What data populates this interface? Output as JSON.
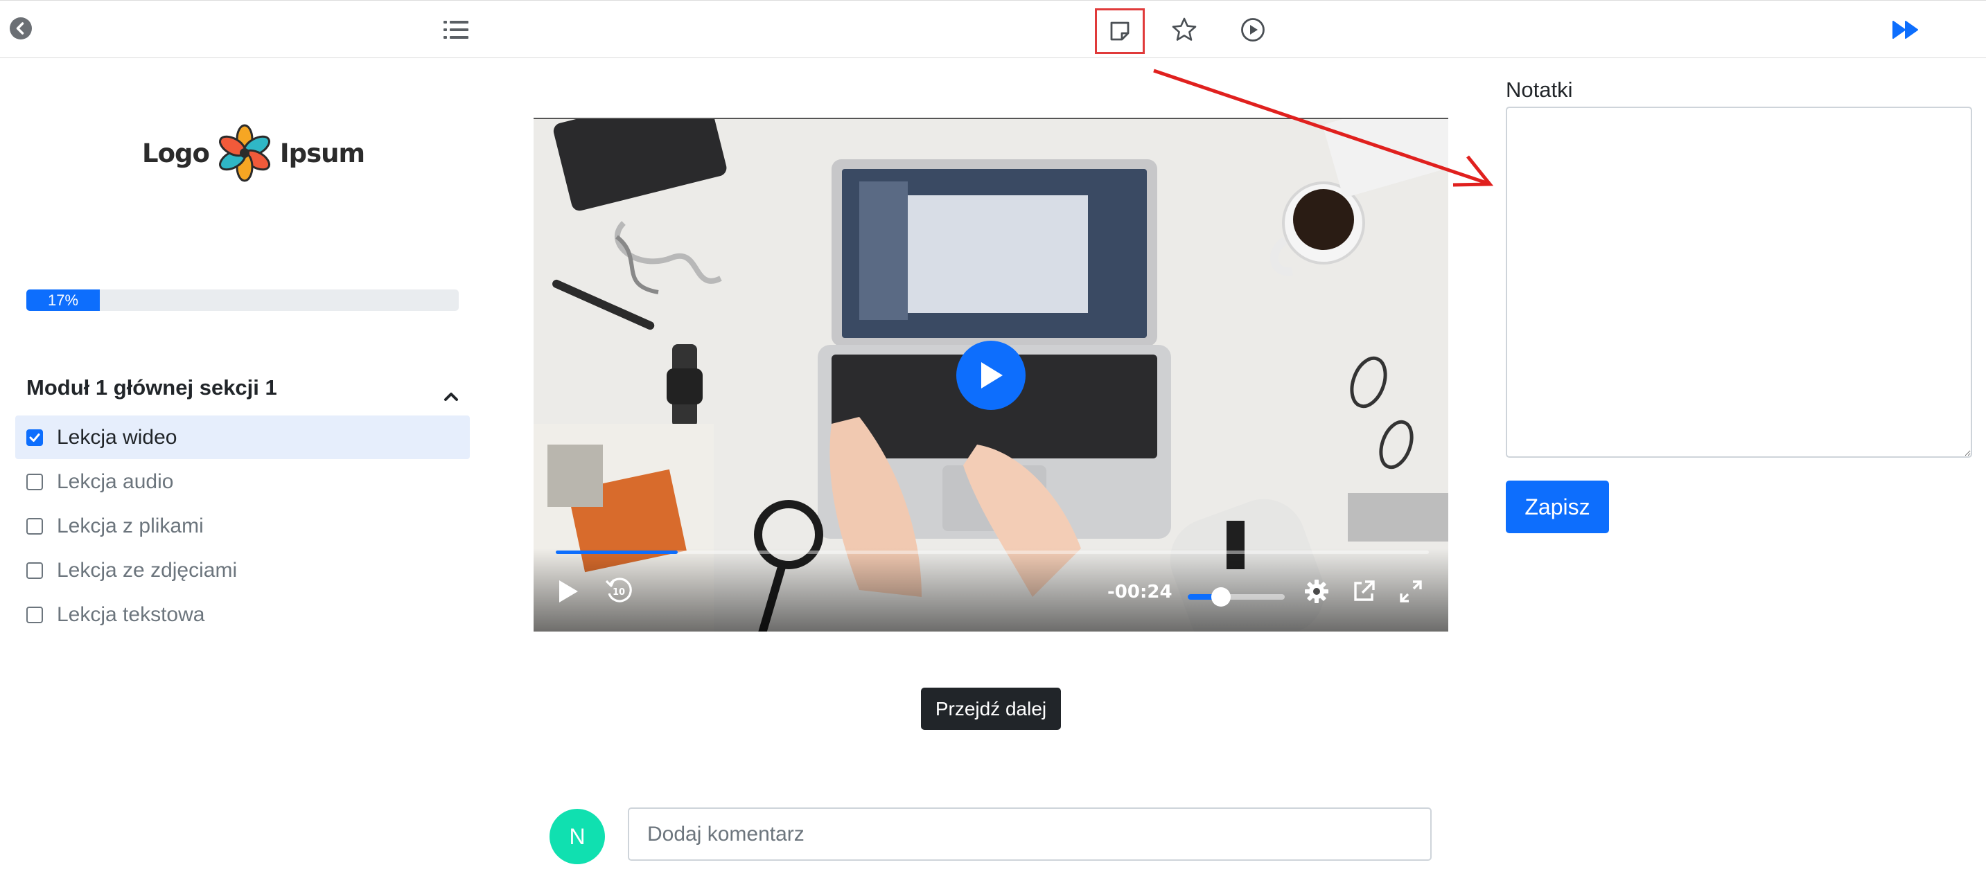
{
  "toolbar": {
    "icons": [
      "back-circle-icon",
      "list-icon",
      "note-icon",
      "star-icon",
      "play-circle-icon",
      "fast-forward-icon"
    ],
    "accent": "#0d6efd",
    "highlight_color": "#e03a3a"
  },
  "sidebar": {
    "logo_left": "Logo",
    "logo_right": "Ipsum",
    "progress": {
      "percent": 17,
      "label": "17%"
    },
    "module": {
      "title": "Moduł 1 głównej sekcji 1",
      "expanded": true
    },
    "lessons": [
      {
        "label": "Lekcja wideo",
        "checked": true,
        "active": true
      },
      {
        "label": "Lekcja audio",
        "checked": false,
        "active": false
      },
      {
        "label": "Lekcja z plikami",
        "checked": false,
        "active": false
      },
      {
        "label": "Lekcja ze zdjęciami",
        "checked": false,
        "active": false
      },
      {
        "label": "Lekcja tekstowa",
        "checked": false,
        "active": false
      }
    ]
  },
  "video": {
    "time_remaining": "-00:24",
    "progress_fraction": 0.14,
    "volume_fraction": 0.34
  },
  "main": {
    "next_label": "Przejdź dalej",
    "avatar_initial": "N",
    "comment_placeholder": "Dodaj komentarz"
  },
  "notes": {
    "label": "Notatki",
    "value": "",
    "save_label": "Zapisz"
  },
  "colors": {
    "accent": "#0d6efd",
    "avatar": "#10e0b0",
    "annotation_arrow": "#e0201e"
  }
}
